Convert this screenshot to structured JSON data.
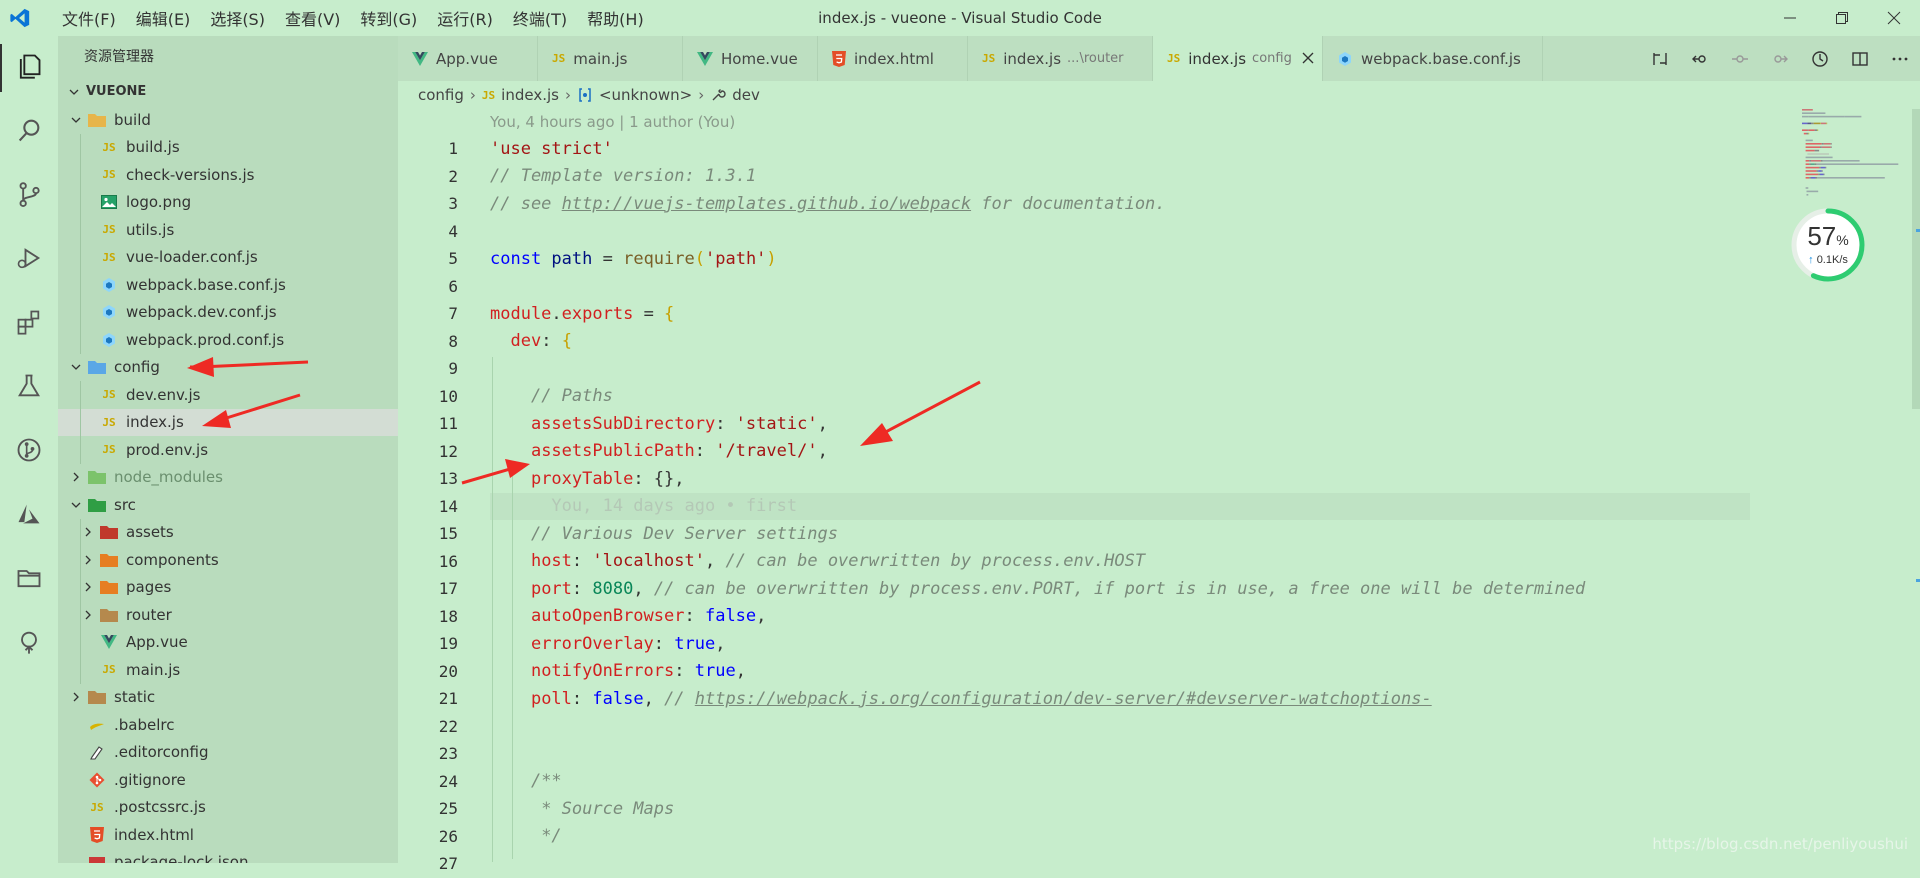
{
  "window": {
    "title": "index.js - vueone - Visual Studio Code",
    "menu": [
      "文件(F)",
      "编辑(E)",
      "选择(S)",
      "查看(V)",
      "转到(G)",
      "运行(R)",
      "终端(T)",
      "帮助(H)"
    ]
  },
  "activity_bar": [
    "explorer-icon",
    "search-icon",
    "source-control-icon",
    "run-debug-icon",
    "extensions-icon",
    "testing-icon",
    "git-graph-icon",
    "azure-icon",
    "folder-icon",
    "tree-icon"
  ],
  "sidebar": {
    "header": "资源管理器",
    "section": "VUEONE",
    "tree": [
      {
        "label": "build",
        "depth": 0,
        "type": "folder",
        "expanded": true
      },
      {
        "label": "build.js",
        "depth": 1,
        "type": "js"
      },
      {
        "label": "check-versions.js",
        "depth": 1,
        "type": "js"
      },
      {
        "label": "logo.png",
        "depth": 1,
        "type": "image"
      },
      {
        "label": "utils.js",
        "depth": 1,
        "type": "js"
      },
      {
        "label": "vue-loader.conf.js",
        "depth": 1,
        "type": "js"
      },
      {
        "label": "webpack.base.conf.js",
        "depth": 1,
        "type": "webpack"
      },
      {
        "label": "webpack.dev.conf.js",
        "depth": 1,
        "type": "webpack"
      },
      {
        "label": "webpack.prod.conf.js",
        "depth": 1,
        "type": "webpack"
      },
      {
        "label": "config",
        "depth": 0,
        "type": "folder",
        "expanded": true
      },
      {
        "label": "dev.env.js",
        "depth": 1,
        "type": "js"
      },
      {
        "label": "index.js",
        "depth": 1,
        "type": "js",
        "selected": true
      },
      {
        "label": "prod.env.js",
        "depth": 1,
        "type": "js"
      },
      {
        "label": "node_modules",
        "depth": 0,
        "type": "folder",
        "expanded": false,
        "dim": true
      },
      {
        "label": "src",
        "depth": 0,
        "type": "folder",
        "expanded": true
      },
      {
        "label": "assets",
        "depth": 1,
        "type": "folder",
        "expanded": false
      },
      {
        "label": "components",
        "depth": 1,
        "type": "folder",
        "expanded": false
      },
      {
        "label": "pages",
        "depth": 1,
        "type": "folder",
        "expanded": false
      },
      {
        "label": "router",
        "depth": 1,
        "type": "folder",
        "expanded": false
      },
      {
        "label": "App.vue",
        "depth": 1,
        "type": "vue"
      },
      {
        "label": "main.js",
        "depth": 1,
        "type": "js"
      },
      {
        "label": "static",
        "depth": 0,
        "type": "folder",
        "expanded": false
      },
      {
        "label": ".babelrc",
        "depth": 0,
        "type": "babel"
      },
      {
        "label": ".editorconfig",
        "depth": 0,
        "type": "editorconfig"
      },
      {
        "label": ".gitignore",
        "depth": 0,
        "type": "git"
      },
      {
        "label": ".postcssrc.js",
        "depth": 0,
        "type": "js"
      },
      {
        "label": "index.html",
        "depth": 0,
        "type": "html"
      },
      {
        "label": "package-lock.json",
        "depth": 0,
        "type": "json"
      }
    ]
  },
  "tabs": [
    {
      "label": "App.vue",
      "type": "vue"
    },
    {
      "label": "main.js",
      "type": "js"
    },
    {
      "label": "Home.vue",
      "type": "vue"
    },
    {
      "label": "index.html",
      "type": "html"
    },
    {
      "label": "index.js",
      "sub": "...\\router",
      "type": "js"
    },
    {
      "label": "index.js",
      "sub": "config",
      "type": "js",
      "active": true
    },
    {
      "label": "webpack.base.conf.js",
      "type": "webpack"
    }
  ],
  "breadcrumb": {
    "folder": "config",
    "file": "index.js",
    "scope": "<unknown>",
    "symbol": "dev"
  },
  "codelens": "You, 4 hours ago | 1 author (You)",
  "code_lines": [
    {
      "n": "1",
      "tokens": [
        [
          "str",
          "'use strict'"
        ]
      ]
    },
    {
      "n": "2",
      "tokens": [
        [
          "cmt",
          "// Template version: 1.3.1"
        ]
      ]
    },
    {
      "n": "3",
      "tokens": [
        [
          "cmt",
          "// see "
        ],
        [
          "link",
          "http://vuejs-templates.github.io/webpack"
        ],
        [
          "cmt",
          " for documentation."
        ]
      ]
    },
    {
      "n": "4",
      "tokens": []
    },
    {
      "n": "5",
      "tokens": [
        [
          "kw",
          "const "
        ],
        [
          "var",
          "path"
        ],
        [
          "punc",
          " = "
        ],
        [
          "fn",
          "require"
        ],
        [
          "brace",
          "("
        ],
        [
          "str",
          "'path'"
        ],
        [
          "brace",
          ")"
        ]
      ]
    },
    {
      "n": "6",
      "tokens": []
    },
    {
      "n": "7",
      "tokens": [
        [
          "key",
          "module"
        ],
        [
          "punc",
          "."
        ],
        [
          "key",
          "exports"
        ],
        [
          "punc",
          " = "
        ],
        [
          "brace",
          "{"
        ]
      ]
    },
    {
      "n": "8",
      "tokens": [
        [
          "punc",
          "  "
        ],
        [
          "key",
          "dev"
        ],
        [
          "punc",
          ": "
        ],
        [
          "brace",
          "{"
        ]
      ]
    },
    {
      "n": "9",
      "tokens": []
    },
    {
      "n": "10",
      "tokens": [
        [
          "punc",
          "    "
        ],
        [
          "cmt",
          "// Paths"
        ]
      ]
    },
    {
      "n": "11",
      "tokens": [
        [
          "punc",
          "    "
        ],
        [
          "key",
          "assetsSubDirectory"
        ],
        [
          "punc",
          ": "
        ],
        [
          "str",
          "'static'"
        ],
        [
          "punc",
          ","
        ]
      ]
    },
    {
      "n": "12",
      "tokens": [
        [
          "punc",
          "    "
        ],
        [
          "key",
          "assetsPublicPath"
        ],
        [
          "punc",
          ": "
        ],
        [
          "str",
          "'/travel/'"
        ],
        [
          "punc",
          ","
        ]
      ]
    },
    {
      "n": "13",
      "tokens": [
        [
          "punc",
          "    "
        ],
        [
          "key",
          "proxyTable"
        ],
        [
          "punc",
          ": {},"
        ]
      ]
    },
    {
      "n": "14",
      "tokens": [
        [
          "punc",
          "      "
        ],
        [
          "blame",
          "You, 14 days ago • first"
        ]
      ],
      "current": true
    },
    {
      "n": "15",
      "tokens": [
        [
          "punc",
          "    "
        ],
        [
          "cmt",
          "// Various Dev Server settings"
        ]
      ]
    },
    {
      "n": "16",
      "tokens": [
        [
          "punc",
          "    "
        ],
        [
          "key",
          "host"
        ],
        [
          "punc",
          ": "
        ],
        [
          "str",
          "'localhost'"
        ],
        [
          "punc",
          ", "
        ],
        [
          "cmt",
          "// can be overwritten by process.env.HOST"
        ]
      ]
    },
    {
      "n": "17",
      "tokens": [
        [
          "punc",
          "    "
        ],
        [
          "key",
          "port"
        ],
        [
          "punc",
          ": "
        ],
        [
          "num",
          "8080"
        ],
        [
          "punc",
          ", "
        ],
        [
          "cmt",
          "// can be overwritten by process.env.PORT, if port is in use, a free one will be determined"
        ]
      ]
    },
    {
      "n": "18",
      "tokens": [
        [
          "punc",
          "    "
        ],
        [
          "key",
          "autoOpenBrowser"
        ],
        [
          "punc",
          ": "
        ],
        [
          "bool",
          "false"
        ],
        [
          "punc",
          ","
        ]
      ]
    },
    {
      "n": "19",
      "tokens": [
        [
          "punc",
          "    "
        ],
        [
          "key",
          "errorOverlay"
        ],
        [
          "punc",
          ": "
        ],
        [
          "bool",
          "true"
        ],
        [
          "punc",
          ","
        ]
      ]
    },
    {
      "n": "20",
      "tokens": [
        [
          "punc",
          "    "
        ],
        [
          "key",
          "notifyOnErrors"
        ],
        [
          "punc",
          ": "
        ],
        [
          "bool",
          "true"
        ],
        [
          "punc",
          ","
        ]
      ]
    },
    {
      "n": "21",
      "tokens": [
        [
          "punc",
          "    "
        ],
        [
          "key",
          "poll"
        ],
        [
          "punc",
          ": "
        ],
        [
          "bool",
          "false"
        ],
        [
          "punc",
          ", "
        ],
        [
          "cmt",
          "// "
        ],
        [
          "link",
          "https://webpack.js.org/configuration/dev-server/#devserver-watchoptions-"
        ]
      ]
    },
    {
      "n": "22",
      "tokens": []
    },
    {
      "n": "23",
      "tokens": []
    },
    {
      "n": "24",
      "tokens": [
        [
          "punc",
          "    "
        ],
        [
          "cmt",
          "/**"
        ]
      ]
    },
    {
      "n": "25",
      "tokens": [
        [
          "punc",
          "     "
        ],
        [
          "cmt",
          "* Source Maps"
        ]
      ]
    },
    {
      "n": "26",
      "tokens": [
        [
          "punc",
          "     "
        ],
        [
          "cmt",
          "*/"
        ]
      ]
    },
    {
      "n": "27",
      "tokens": []
    }
  ],
  "network_gauge": {
    "percent": "57",
    "percent_unit": "%",
    "speed": "0.1K/s",
    "speed_arrow": "↑"
  },
  "watermark": "https://blog.csdn.net/penliyoushui",
  "colors": {
    "background": "#c7edcc",
    "sidebar": "#b9dcbd",
    "arrow": "#ee2a24",
    "gauge": "#2ecc71"
  }
}
